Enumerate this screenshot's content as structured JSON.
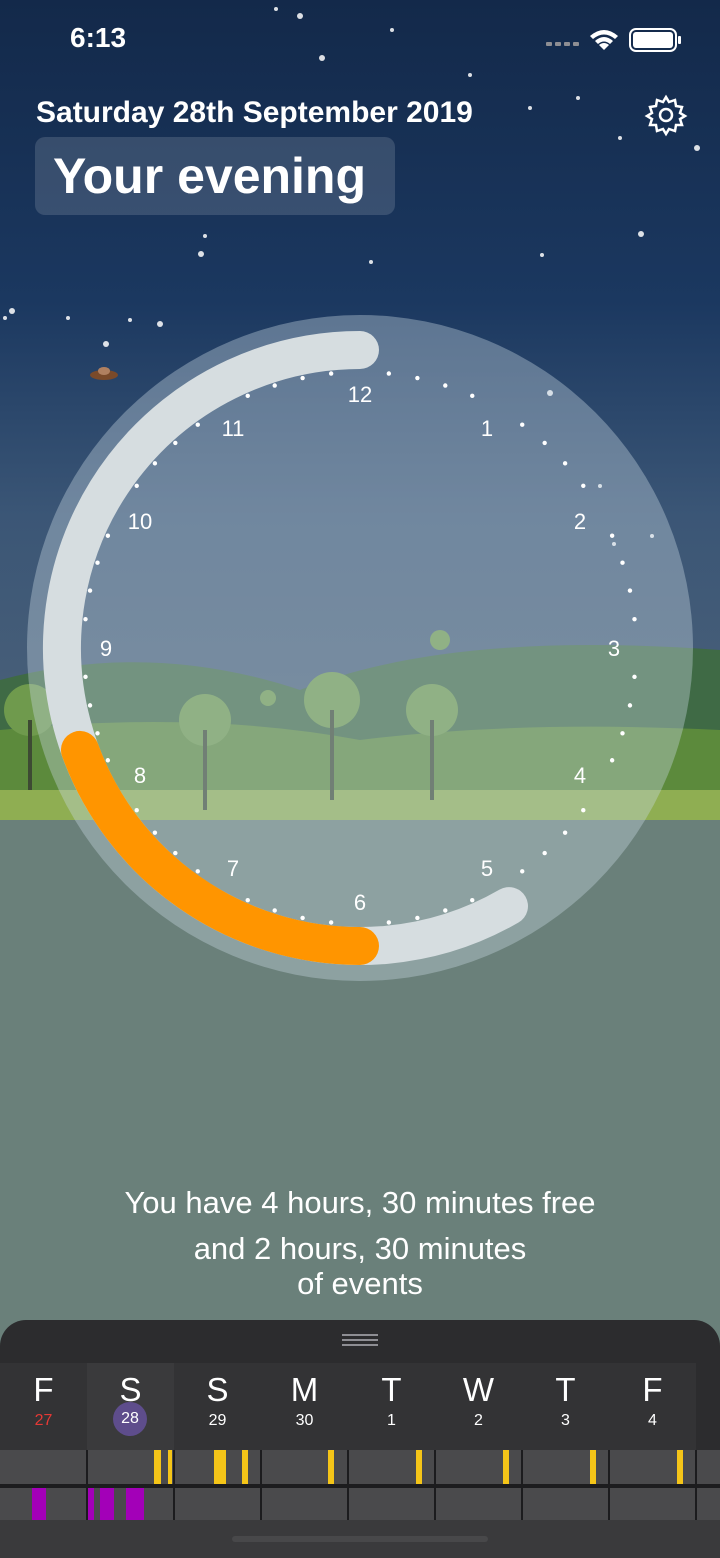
{
  "status_bar": {
    "time": "6:13"
  },
  "header": {
    "date": "Saturday 28th September 2019",
    "title": "Your evening"
  },
  "clock": {
    "numbers": [
      "12",
      "1",
      "2",
      "3",
      "4",
      "5",
      "6",
      "7",
      "8",
      "9",
      "10",
      "11"
    ],
    "current_time": "6:13",
    "evening_range": [
      "17:00",
      "24:00"
    ],
    "elapsed_range": [
      "17:00",
      "18:13"
    ]
  },
  "summary": {
    "line1": "You have 4 hours, 30 minutes free",
    "line2": "and 2 hours, 30 minutes",
    "line3": "of events"
  },
  "calendar": {
    "selected_index": 1,
    "days": [
      {
        "letter": "F",
        "num": "27"
      },
      {
        "letter": "S",
        "num": "28"
      },
      {
        "letter": "S",
        "num": "29"
      },
      {
        "letter": "M",
        "num": "30"
      },
      {
        "letter": "T",
        "num": "1"
      },
      {
        "letter": "W",
        "num": "2"
      },
      {
        "letter": "T",
        "num": "3"
      },
      {
        "letter": "F",
        "num": "4"
      }
    ],
    "past_day_color": "#e53935",
    "selected_color": "#5e4d8c",
    "event_colors": {
      "yellow": "#f5c518",
      "purple": "#a300b8"
    }
  },
  "colors": {
    "accent_orange": "#ff9500",
    "ring": "#d6dde0",
    "sky_top": "#13294a"
  },
  "icons": [
    "settings-gear-icon",
    "wifi-icon",
    "battery-icon",
    "signal-icon",
    "ufo-icon",
    "drag-handle-icon"
  ]
}
